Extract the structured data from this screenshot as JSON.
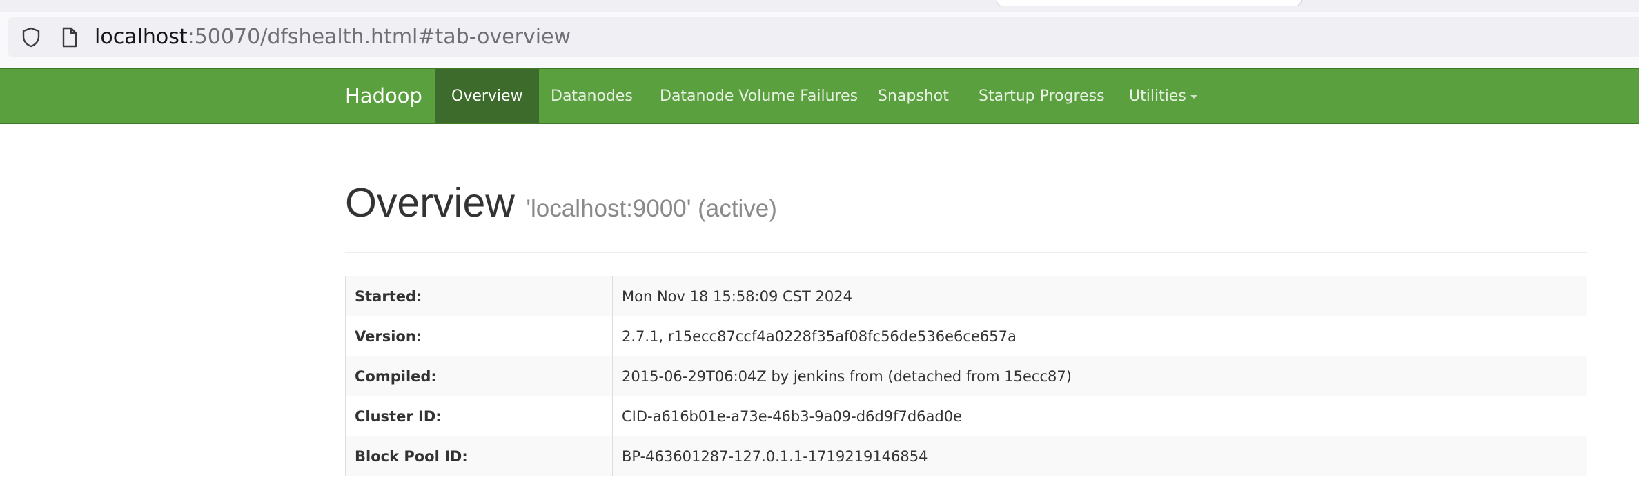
{
  "browser": {
    "url_host": "localhost",
    "url_rest": ":50070/dfshealth.html#tab-overview"
  },
  "navbar": {
    "brand": "Hadoop",
    "items": [
      {
        "label": "Overview",
        "active": true
      },
      {
        "label": "Datanodes",
        "active": false
      },
      {
        "label": "Datanode Volume Failures",
        "active": false
      },
      {
        "label": "Snapshot",
        "active": false
      },
      {
        "label": "Startup Progress",
        "active": false
      },
      {
        "label": "Utilities",
        "active": false
      }
    ],
    "color": "#5aa03e",
    "active_color": "#3c6b2c"
  },
  "page": {
    "title": "Overview",
    "subtitle": "'localhost:9000' (active)"
  },
  "overview_table": {
    "rows": [
      {
        "key": "Started:",
        "value": "Mon Nov 18 15:58:09 CST 2024"
      },
      {
        "key": "Version:",
        "value": "2.7.1, r15ecc87ccf4a0228f35af08fc56de536e6ce657a"
      },
      {
        "key": "Compiled:",
        "value": "2015-06-29T06:04Z by jenkins from (detached from 15ecc87)"
      },
      {
        "key": "Cluster ID:",
        "value": "CID-a616b01e-a73e-46b3-9a09-d6d9f7d6ad0e"
      },
      {
        "key": "Block Pool ID:",
        "value": "BP-463601287-127.0.1.1-1719219146854"
      }
    ]
  },
  "icons": {
    "tracking_protection": "shield-icon",
    "page_info": "page-icon",
    "dropdown": "caret-down-icon"
  }
}
